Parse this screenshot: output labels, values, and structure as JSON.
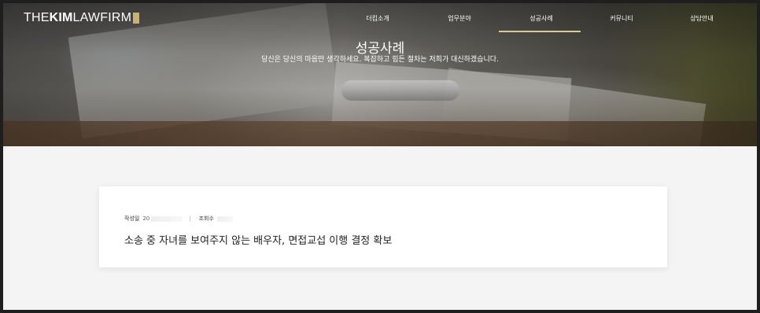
{
  "logo": {
    "the": "THE",
    "kim": "KIM",
    "lawfirm": "LAWFIRM"
  },
  "nav": [
    {
      "label": "더킴소개"
    },
    {
      "label": "업무분야"
    },
    {
      "label": "성공사례"
    },
    {
      "label": "커뮤니티"
    },
    {
      "label": "상담안내"
    }
  ],
  "hero": {
    "title": "성공사례",
    "subtitle": "당신은 당신의 마음만 생각하세요. 복잡하고 힘든 절차는 저희가 대신하겠습니다."
  },
  "post": {
    "date_label": "작성일",
    "date_value": "20",
    "views_label": "조회수",
    "title": "소송 중 자녀를 보여주지 않는 배우자, 면접교섭 이행 결정 확보"
  },
  "colors": {
    "accent": "#d9c898",
    "logo_mark": "#c9b27a"
  }
}
